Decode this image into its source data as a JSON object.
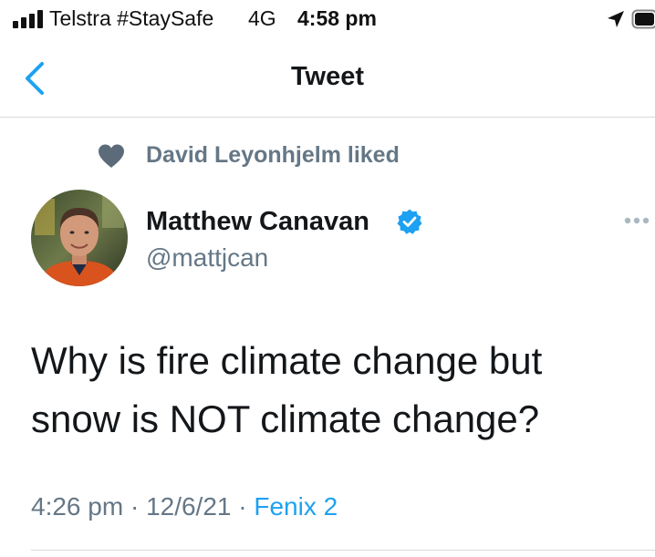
{
  "status_bar": {
    "carrier": "Telstra #StaySafe",
    "network": "4G",
    "time": "4:58 pm",
    "icons": [
      "signal-icon",
      "location-icon",
      "battery-icon"
    ]
  },
  "nav": {
    "back_icon": "chevron-left-icon",
    "title": "Tweet"
  },
  "social_context": {
    "icon": "heart-icon",
    "text": "David Leyonhjelm liked"
  },
  "author": {
    "name": "Matthew Canavan",
    "handle": "@mattjcan",
    "verified": true,
    "avatar": "avatar-photo"
  },
  "tweet": {
    "text": "Why is fire climate change but snow is NOT climate change?"
  },
  "meta": {
    "time": "4:26 pm",
    "separator": "·",
    "date": "12/6/21",
    "client": "Fenix 2"
  },
  "colors": {
    "accent": "#1da1f2",
    "text_primary": "#14171a",
    "text_secondary": "#657786",
    "divider": "#d6d9db"
  }
}
